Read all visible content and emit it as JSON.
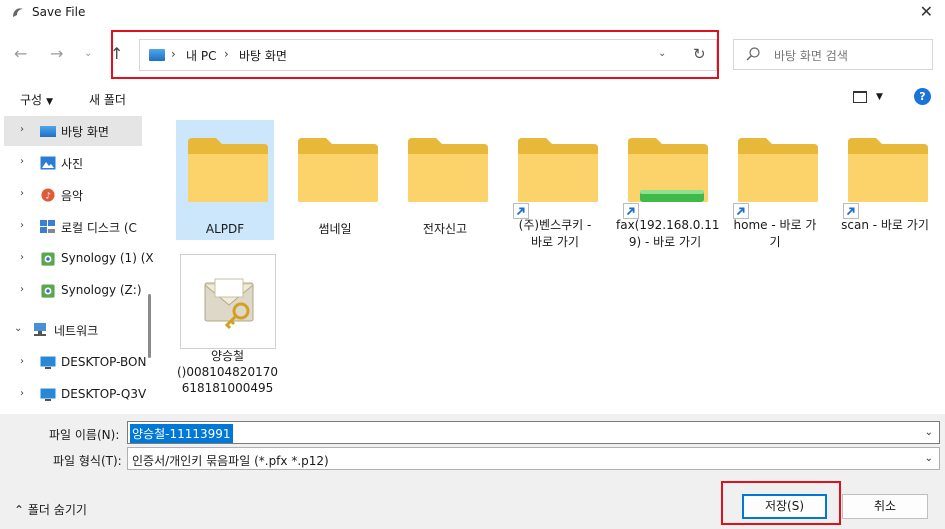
{
  "window": {
    "title": "Save File"
  },
  "nav": {
    "breadcrumb": [
      "내 PC",
      "바탕 화면"
    ],
    "search_placeholder": "바탕 화면 검색"
  },
  "toolbar": {
    "organize": "구성",
    "new_folder": "새 폴더"
  },
  "sidebar": {
    "items": [
      {
        "label": "바탕 화면",
        "icon": "desktop-icon"
      },
      {
        "label": "사진",
        "icon": "pictures-icon"
      },
      {
        "label": "음악",
        "icon": "music-icon"
      },
      {
        "label": "로컬 디스크 (C",
        "icon": "disk-icon"
      },
      {
        "label": "Synology (1) (X",
        "icon": "network-drive-icon"
      },
      {
        "label": "Synology (Z:)",
        "icon": "network-drive-icon"
      },
      {
        "label": "네트워크",
        "icon": "network-icon"
      },
      {
        "label": "DESKTOP-BON",
        "icon": "computer-icon"
      },
      {
        "label": "DESKTOP-Q3V",
        "icon": "computer-icon"
      }
    ]
  },
  "files": [
    {
      "name": "ALPDF"
    },
    {
      "name": "썸네일"
    },
    {
      "name": "전자신고"
    },
    {
      "name": "(주)벤스쿠키 -",
      "name2": "바로 가기"
    },
    {
      "name": "fax(192.168.0.11",
      "name2": "9) - 바로 가기"
    },
    {
      "name": "home - 바로 가",
      "name2": "기"
    },
    {
      "name": "scan - 바로 가기"
    }
  ],
  "cert_file": {
    "line1": "양승철",
    "line2": "()008104820170",
    "line3": "618181000495"
  },
  "form": {
    "filename_label": "파일 이름(N):",
    "filename_value": "양승철-11113991",
    "filetype_label": "파일 형식(T):",
    "filetype_value": "인증서/개인키 묶음파일 (*.pfx *.p12)",
    "hide_folders": "폴더 숨기기",
    "save": "저장(S)",
    "cancel": "취소"
  }
}
